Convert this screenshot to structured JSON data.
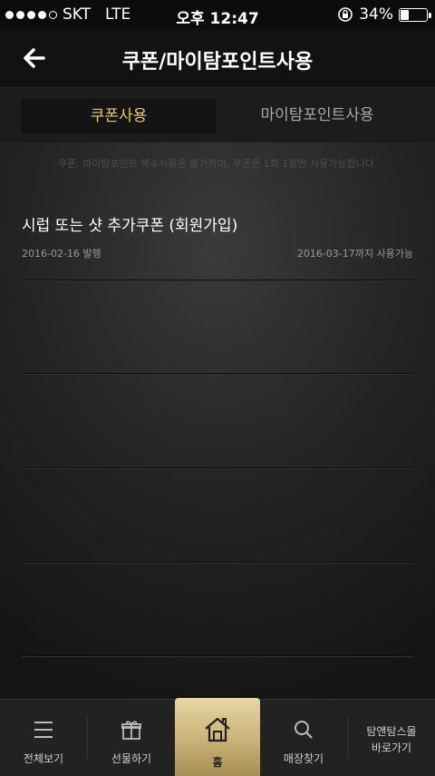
{
  "status_bar": {
    "carrier": "SKT",
    "network": "LTE",
    "time": "오후 12:47",
    "battery": "34%",
    "battery_level": 0.34
  },
  "header": {
    "title": "쿠폰/마이탐포인트사용",
    "back_icon": "arrow-left-icon"
  },
  "tabs": [
    {
      "label": "쿠폰사용",
      "active": true
    },
    {
      "label": "마이탐포인트사용",
      "active": false
    }
  ],
  "notice": "쿠폰, 마이탐포인트 복수사용은 불가하며, 쿠폰은 1회 1장만 사용가능합니다.",
  "coupons": [
    {
      "title": "시럽 또는 샷 추가쿠폰 (회원가입)",
      "issued": "2016-02-16 발행",
      "expires": "2016-03-17까지 사용가능"
    }
  ],
  "colors": {
    "accent": "#e8c77a",
    "home_gold": "#c9b277",
    "background": "#262626"
  },
  "bottom_nav": [
    {
      "label": "전체보기",
      "icon": "menu-icon"
    },
    {
      "label": "선물하기",
      "icon": "gift-icon"
    },
    {
      "label": "홈",
      "icon": "home-icon"
    },
    {
      "label": "매장찾기",
      "icon": "search-icon"
    },
    {
      "label_line1": "탐앤탐스몰",
      "label_line2": "바로가기"
    }
  ]
}
